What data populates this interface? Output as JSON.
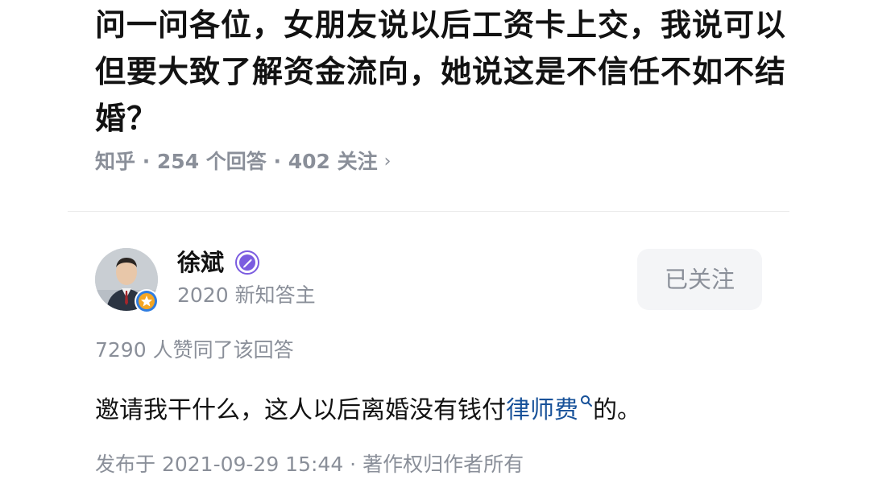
{
  "question": {
    "title": "问一问各位，女朋友说以后工资卡上交，我说可以但要大致了解资金流向，她说这是不信任不如不结婚？",
    "meta": "知乎 · 254 个回答 · 402 关注",
    "chevron": "›"
  },
  "author": {
    "name": "徐斌",
    "tag": "2020 新知答主",
    "avatar_icon": "user-avatar-photo",
    "badge_icon": "honor-badge-icon",
    "verify_icon": "verified-author-icon",
    "follow_label": "已关注"
  },
  "answer": {
    "upvotes": "7290 人赞同了该回答",
    "text_before": "邀请我干什么，这人以后离婚没有钱付",
    "keyword": "律师费",
    "text_after": "的。",
    "published": "发布于 2021-09-29 15:44 · 著作权归作者所有"
  },
  "colors": {
    "text_primary": "#121212",
    "text_secondary": "#8a8f99",
    "link_blue": "#175199",
    "button_bg": "#f4f5f7",
    "verify_purple": "#7b5ce0",
    "badge_orange": "#f5a623",
    "badge_ring_blue": "#2f7de1"
  }
}
